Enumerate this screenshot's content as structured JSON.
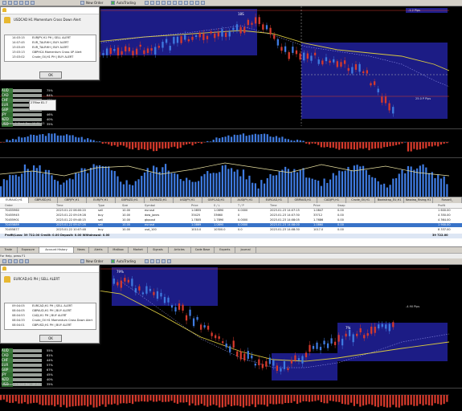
{
  "top": {
    "toolbar": {
      "new_order": "New Order",
      "autotrading": "AutoTrading"
    },
    "alert": {
      "message": "USDCAD H1 Momentum Cross Down Alert",
      "rows": [
        {
          "time": "14:03:15",
          "text": "EURJPY,H1 PH | SELL ALERT"
        },
        {
          "time": "14:07:45",
          "text": "EUR_TALRHH | BUY ALERT"
        },
        {
          "time": "13:03:49",
          "text": "EUR_TALRHH | BUY ALERT"
        },
        {
          "time": "13:03:13",
          "text": "GBPHCA Momentum Cross UP Alert"
        },
        {
          "time": "13:03:02",
          "text": "Crude_Oil,H1 PH | BUY ALERT"
        }
      ],
      "ok": "OK"
    },
    "signal_list": {
      "items": [
        {
          "sym": "AUD",
          "pct": "75%"
        },
        {
          "sym": "CAD",
          "pct": "64%"
        },
        {
          "sym": "CHF",
          "pct": "43%"
        },
        {
          "sym": "EUR",
          "pct": "55%"
        },
        {
          "sym": "GBP",
          "pct": "62%"
        },
        {
          "sym": "JPY",
          "pct": "46%"
        },
        {
          "sym": "NZD",
          "pct": "40%"
        },
        {
          "sym": "USD",
          "pct": "35%"
        }
      ],
      "tooltip": "27Rise 81.7"
    },
    "chart_labels": {
      "box_top": "18S",
      "box_right": "-1.2 Pips",
      "box_bottom_right": "25.0 P Pips",
      "spread": "Spread: 2   Start Bar: 10   81   13"
    }
  },
  "terminal": {
    "tabs": [
      "EURAUD,H1",
      "GBPUSD,H1",
      "GBPJPY,H1",
      "EURJPY,H1",
      "GBPNZD,H1",
      "EURNZD,H1",
      "USDJPY,H1",
      "GBPCAD,H1",
      "AUDJPY,H1",
      "EURCAD,H1",
      "GBPAUD,H1",
      "CADJPY,H1",
      "Crude_Oil,H1",
      "Bootstrap_EU,H1",
      "Nasdaq_Rising,H1",
      "Russell_"
    ],
    "headers": [
      "Order",
      "Time",
      "Type",
      "Size",
      "Symbol",
      "Price",
      "S / L",
      "T / P",
      "Time",
      "Price",
      "Swap",
      "Profit"
    ],
    "rows": [
      [
        "70455960",
        "2023.01.22 06:00:20",
        "sell",
        "10.00",
        "eurusd",
        "1.0855",
        "1.0890",
        "0.0000",
        "2023.01.23 14:07:15",
        "1.0847",
        "0.00",
        "1 600.00"
      ],
      [
        "70455945",
        "2023.01.22 09:19:28",
        "buy",
        "10.00",
        "dow_jones",
        "33425",
        "33660",
        "0",
        "2023.01.23 14:07:30",
        "33712",
        "0.00",
        "4 350.00"
      ],
      [
        "70455901",
        "2023.01.22 09:40:15",
        "sell",
        "10.00",
        "gbpusd",
        "1.7805",
        "1.7890",
        "0.0000",
        "2023.01.23 14:08:05",
        "1.7686",
        "0.00",
        "4 364.00"
      ],
      [
        "70455889",
        "2023.01.22 09:47:26",
        "sell",
        "10.00",
        "eurusd",
        "1.0869",
        "1.0895",
        "0.0000",
        "2023.01.23 14:08:00",
        "1.0860",
        "0.00",
        "1 900.00"
      ],
      [
        "70455877",
        "2023.01.22 10:07:48",
        "buy",
        "10.00",
        "usd_100",
        "1010.0",
        "10300.0",
        "0.0",
        "2023.01.23 14:08:30",
        "1017.0",
        "0.00",
        "8 337.00"
      ]
    ],
    "summary": "Profit/Loss: 39 722.00   Credit: 0.00   Deposit: 0.00   Withdrawal: 0.00",
    "summary_total": "39 722.00",
    "bottom_tabs": [
      "Trade",
      "Exposure",
      "Account History",
      "News",
      "Alerts",
      "Mailbox",
      "Market",
      "Signals",
      "Articles",
      "Code Base",
      "Experts",
      "Journal"
    ]
  },
  "bottom": {
    "status_left": "For Help, press F1",
    "toolbar": {
      "new_order": "New Order",
      "autotrading": "AutoTrading"
    },
    "alert": {
      "message": "EURCAD,H1 PH | SELL ALERT",
      "rows": [
        {
          "time": "09:04:05",
          "text": "EURCAD,H1 PH | SELL ALERT"
        },
        {
          "time": "08:04:05",
          "text": "GBPAUD,H1 PH | BUY ALERT"
        },
        {
          "time": "08:04:53",
          "text": "CADJ,H1 PH | BUY ALERT"
        },
        {
          "time": "08:04:33",
          "text": "Crude_Oil H1 Momentum Cross Down Alert"
        },
        {
          "time": "08:04:01",
          "text": "GBPUSD,H1 PH | BUY ALERT"
        }
      ],
      "ok": "OK"
    },
    "signal_list": {
      "items": [
        {
          "sym": "AUD",
          "pct": "55%"
        },
        {
          "sym": "CAD",
          "pct": "61%"
        },
        {
          "sym": "CHF",
          "pct": "44%"
        },
        {
          "sym": "EUR",
          "pct": "57%"
        },
        {
          "sym": "GBP",
          "pct": "67%"
        },
        {
          "sym": "JPY",
          "pct": "45%"
        },
        {
          "sym": "NZD",
          "pct": "40%"
        },
        {
          "sym": "USD",
          "pct": "35%"
        }
      ]
    },
    "chart_labels": {
      "box_top": "79%",
      "box_right": "-4.90 Pips",
      "box_mid": "7%",
      "spread": "Spread: 3   Start Bar: 49   84"
    }
  },
  "colors": {
    "bull": "#3f7be0",
    "bear": "#d63a2c",
    "ma": "#d8c840",
    "box": "#1e1e8c"
  }
}
